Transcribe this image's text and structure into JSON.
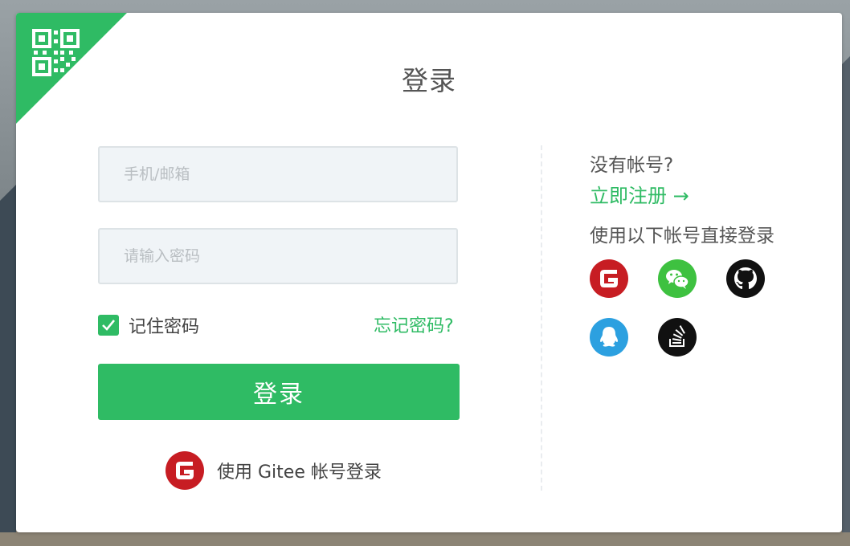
{
  "login": {
    "title": "登录",
    "account_placeholder": "手机/邮箱",
    "password_placeholder": "请输入密码",
    "remember_label": "记住密码",
    "forgot_label": "忘记密码?",
    "submit_label": "登录",
    "gitee_login_label": "使用 Gitee 帐号登录"
  },
  "side": {
    "no_account": "没有帐号?",
    "register_label": "立即注册 →",
    "third_party_title": "使用以下帐号直接登录",
    "providers": [
      "gitee",
      "wechat",
      "github",
      "qq",
      "stackoverflow"
    ]
  },
  "colors": {
    "accent": "#2fbb64",
    "gitee": "#c71d23",
    "wechat": "#3ec140",
    "qq": "#2ca0e0",
    "dark": "#111111"
  }
}
